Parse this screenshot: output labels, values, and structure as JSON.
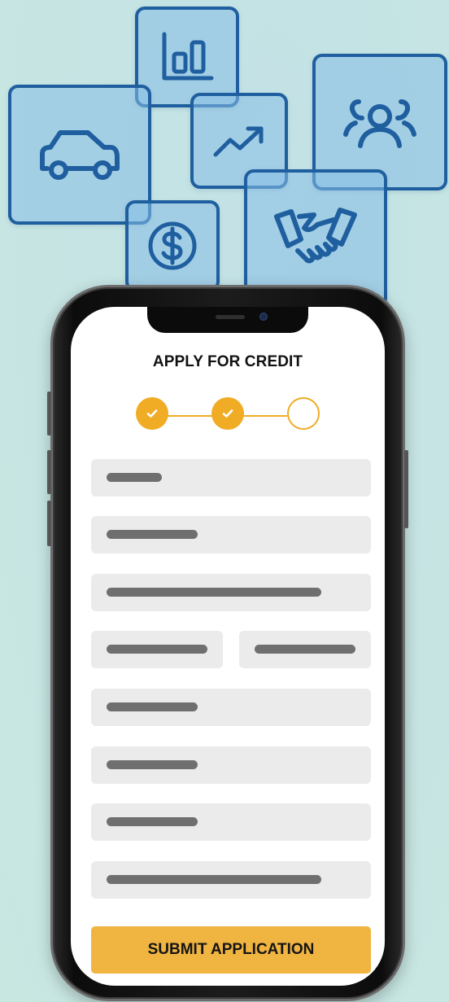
{
  "background": {
    "icons": [
      "bar-chart-icon",
      "car-icon",
      "trend-up-icon",
      "people-icon",
      "dollar-icon",
      "handshake-icon"
    ],
    "colors": {
      "tile_border": "#1f5f9f",
      "tile_fill": "#87bee6",
      "backdrop": "#c5e4e3"
    }
  },
  "form": {
    "title": "APPLY FOR CREDIT",
    "steps": [
      {
        "state": "completed",
        "icon": "check-icon"
      },
      {
        "state": "completed",
        "icon": "check-icon"
      },
      {
        "state": "current"
      }
    ],
    "fields": [
      "placeholder-field-1",
      "placeholder-field-2",
      "placeholder-field-3",
      "placeholder-field-4a",
      "placeholder-field-4b",
      "placeholder-field-5",
      "placeholder-field-6",
      "placeholder-field-7",
      "placeholder-field-8"
    ],
    "submit_label": "SUBMIT APPLICATION",
    "colors": {
      "accent": "#f0ac25",
      "button": "#f0b441",
      "field_bg": "#ebebeb",
      "placeholder_bar": "#6f6f6f"
    }
  }
}
